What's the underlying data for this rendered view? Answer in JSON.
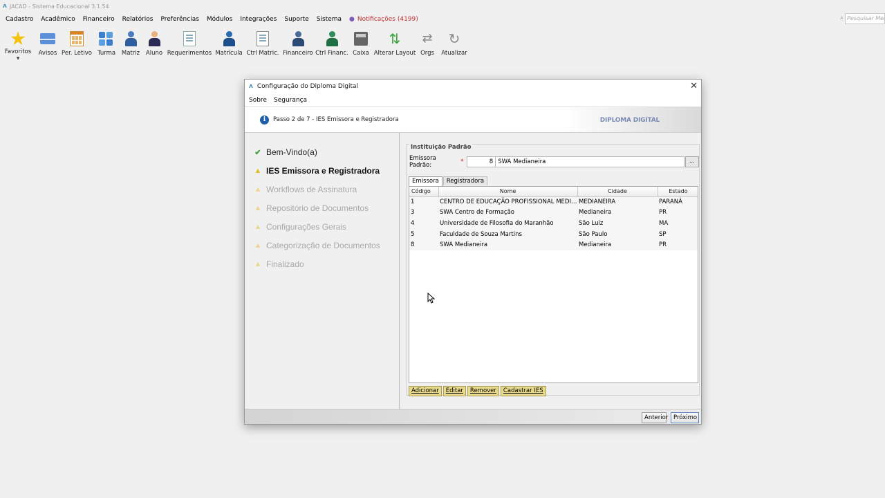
{
  "app": {
    "title": "JACAD - Sistema Educacional 3.1.54",
    "search_placeholder": "Pesquisar Menu"
  },
  "menubar": [
    "Cadastro",
    "Acadêmico",
    "Financeiro",
    "Relatórios",
    "Preferências",
    "Módulos",
    "Integrações",
    "Suporte",
    "Sistema"
  ],
  "notifications": "Notificações (4199)",
  "toolbar": {
    "favoritos": "Favoritos",
    "avisos": "Avisos",
    "per_letivo": "Per. Letivo",
    "turma": "Turma",
    "matriz": "Matriz",
    "aluno": "Aluno",
    "requerimentos": "Requerimentos",
    "matricula": "Matrícula",
    "ctrl_matric": "Ctrl Matric.",
    "financeiro": "Financeiro",
    "ctrl_financ": "Ctrl Financ.",
    "caixa": "Caixa",
    "alterar_layout": "Alterar Layout",
    "orgs": "Orgs",
    "atualizar": "Atualizar"
  },
  "dialog": {
    "title": "Configuração do Diploma Digital",
    "menu": [
      "Sobre",
      "Segurança"
    ],
    "step_info": "Passo 2 de 7 - IES Emissora e Registradora",
    "brand": "DIPLOMA DIGITAL",
    "steps": [
      {
        "label": "Bem-Vindo(a)",
        "state": "done"
      },
      {
        "label": "IES Emissora e Registradora",
        "state": "active"
      },
      {
        "label": "Workflows de Assinatura",
        "state": "future"
      },
      {
        "label": "Repositório de Documentos",
        "state": "future"
      },
      {
        "label": "Configurações Gerais",
        "state": "future"
      },
      {
        "label": "Categorização de Documentos",
        "state": "future"
      },
      {
        "label": "Finalizado",
        "state": "future"
      }
    ],
    "group_title": "Instituição Padrão",
    "field_label": "Emissora Padrão:",
    "field_code": "8",
    "field_name": "SWA Medianeira",
    "browse": "...",
    "tabs": [
      "Emissora",
      "Registradora"
    ],
    "columns": [
      "Código",
      "Nome",
      "Cidade",
      "Estado"
    ],
    "rows": [
      [
        "1",
        "CENTRO DE EDUCAÇÃO PROFISSIONAL MEDIANEI...",
        "MEDIANEIRA",
        "PARANÁ"
      ],
      [
        "3",
        "SWA Centro de Formação",
        "Medianeira",
        "PR"
      ],
      [
        "4",
        "Universidade de Filosofia do Maranhão",
        "São Luiz",
        "MA"
      ],
      [
        "5",
        "Faculdade de Souza Martins",
        "São Paulo",
        "SP"
      ],
      [
        "8",
        "SWA Medianeira",
        "Medianeira",
        "PR"
      ]
    ],
    "actions": [
      "Adicionar",
      "Editar",
      "Remover",
      "Cadastrar IES"
    ],
    "prev": "Anterior",
    "next": "Próximo"
  }
}
